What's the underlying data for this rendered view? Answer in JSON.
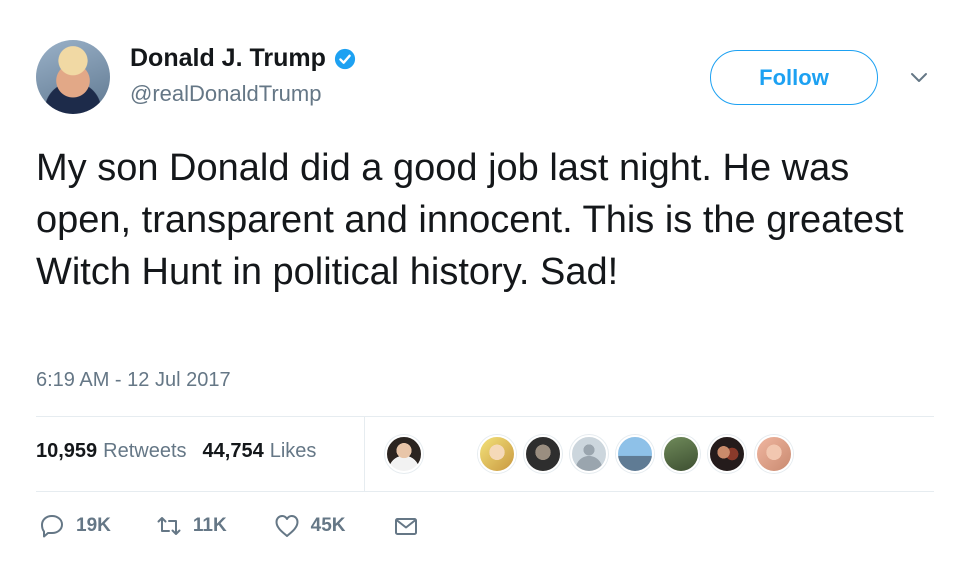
{
  "user": {
    "display_name": "Donald J. Trump",
    "handle": "@realDonaldTrump",
    "verified": true
  },
  "follow_label": "Follow",
  "tweet": {
    "text": "My son Donald did a good job last night. He was open, transparent and innocent. This is the greatest Witch Hunt in political history. Sad!",
    "timestamp": "6:19 AM - 12 Jul 2017"
  },
  "stats": {
    "retweets_count": "10,959",
    "retweets_label": "Retweets",
    "likes_count": "44,754",
    "likes_label": "Likes"
  },
  "actions": {
    "replies": "19K",
    "retweets": "11K",
    "likes": "45K"
  },
  "colors": {
    "brand_blue": "#1da1f2",
    "muted_text": "#657786",
    "divider": "#e6ecf0"
  }
}
